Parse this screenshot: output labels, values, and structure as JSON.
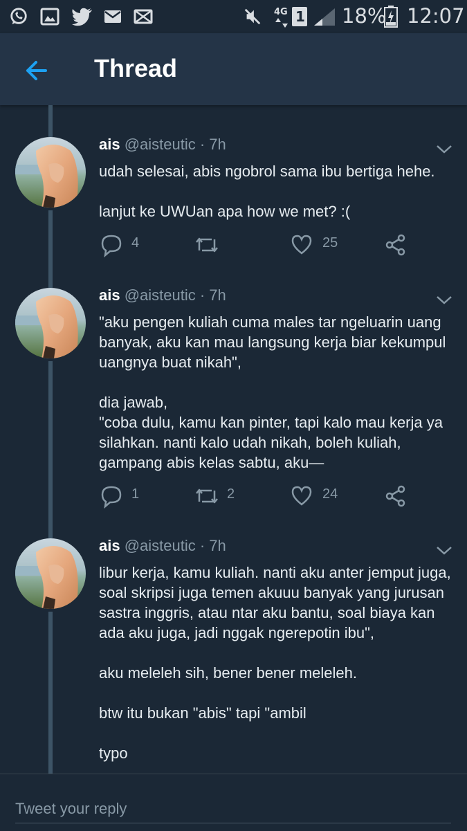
{
  "status_bar": {
    "network": "4G",
    "sim": "1",
    "battery": "18%",
    "time": "12:07",
    "notification_icons": [
      "whatsapp-icon",
      "gallery-icon",
      "twitter-icon",
      "mail-icon",
      "mail-icon"
    ]
  },
  "header": {
    "title": "Thread",
    "back_icon": "back-arrow-icon"
  },
  "tweets": [
    {
      "name": "ais",
      "handle": "@aisteutic · 7h",
      "text": "udah selesai, abis ngobrol sama ibu bertiga hehe.\n\nlanjut ke UWUan apa how we met? :(",
      "replies": "4",
      "retweets": "",
      "likes": "25"
    },
    {
      "name": "ais",
      "handle": "@aisteutic · 7h",
      "text": "\"aku pengen kuliah cuma males tar ngeluarin uang banyak, aku kan mau langsung kerja biar kekumpul uangnya buat nikah\",\n\ndia jawab,\n\"coba dulu, kamu kan pinter, tapi kalo mau kerja ya silahkan. nanti kalo udah nikah, boleh kuliah, gampang abis kelas sabtu, aku—",
      "replies": "1",
      "retweets": "2",
      "likes": "24"
    },
    {
      "name": "ais",
      "handle": "@aisteutic · 7h",
      "text": "libur kerja, kamu kuliah. nanti aku anter jemput juga, soal skripsi juga temen akuuu banyak yang jurusan sastra inggris, atau ntar aku bantu, soal biaya kan ada aku juga, jadi nggak ngerepotin ibu\",\n\naku meleleh sih, bener bener meleleh.\n\nbtw itu bukan \"abis\" tapi \"ambil\n\ntypo"
    }
  ],
  "reply": {
    "placeholder": "Tweet your reply"
  },
  "colors": {
    "background": "#1b2836",
    "header": "#243447",
    "accent": "#1da1f2",
    "secondary_text": "#8899a6"
  }
}
